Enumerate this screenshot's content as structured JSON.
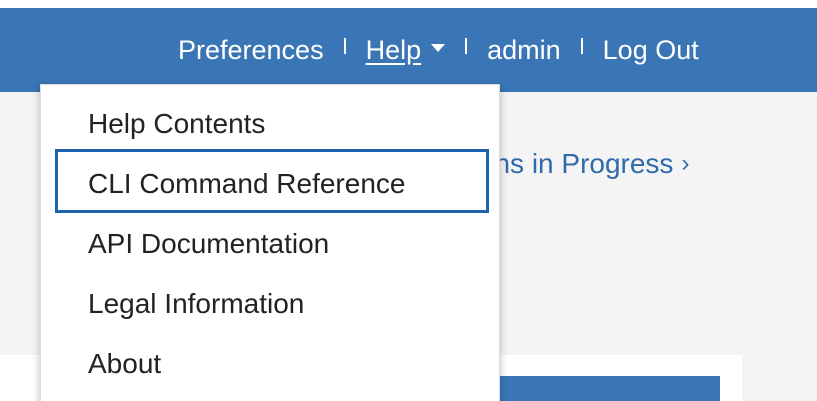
{
  "header": {
    "nav": {
      "preferences": "Preferences",
      "help": "Help",
      "user": "admin",
      "logout": "Log Out"
    }
  },
  "content": {
    "link_partial": "rations in Progress",
    "link_chevron": "›"
  },
  "help_menu": {
    "items": [
      {
        "label": "Help Contents"
      },
      {
        "label": "CLI Command Reference"
      },
      {
        "label": "API Documentation"
      },
      {
        "label": "Legal Information"
      },
      {
        "label": "About"
      }
    ],
    "highlighted_item": "CLI Command Reference",
    "highlight_color": "#1e63b0"
  },
  "colors": {
    "header_bg": "#3a76b6",
    "link": "#2f6aab"
  }
}
